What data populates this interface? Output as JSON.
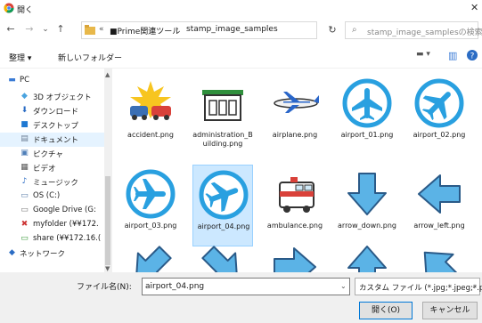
{
  "window": {
    "title": "開く",
    "close_glyph": "✕"
  },
  "nav": {
    "back_glyph": "←",
    "forward_glyph": "→",
    "recent_glyph": "⌄",
    "up_glyph": "↑",
    "address_overflow": "«",
    "address_segments": [
      "■Prime関連ツール",
      "stamp_image_samples"
    ],
    "address_separator": "›",
    "refresh_glyph": "↻",
    "search_placeholder": "stamp_image_samplesの検索"
  },
  "toolbar": {
    "organize_label": "整理 ▾",
    "new_folder_label": "新しいフォルダー"
  },
  "sidebar": {
    "items": [
      {
        "label": "PC",
        "icon": "pc-icon",
        "glyph": "▬",
        "color": "#3a7bd5",
        "indent": 0
      },
      {
        "label": "3D オブジェクト",
        "icon": "3d-objects-icon",
        "glyph": "◆",
        "color": "#4aa3df",
        "indent": 1
      },
      {
        "label": "ダウンロード",
        "icon": "download-icon",
        "glyph": "⬇",
        "color": "#2b6cc4",
        "indent": 1
      },
      {
        "label": "デスクトップ",
        "icon": "desktop-icon",
        "glyph": "■",
        "color": "#1e78d2",
        "indent": 1
      },
      {
        "label": "ドキュメント",
        "icon": "documents-icon",
        "glyph": "▤",
        "color": "#6b7c93",
        "indent": 1,
        "selected": true
      },
      {
        "label": "ピクチャ",
        "icon": "pictures-icon",
        "glyph": "▣",
        "color": "#4f7fb8",
        "indent": 1
      },
      {
        "label": "ビデオ",
        "icon": "videos-icon",
        "glyph": "▦",
        "color": "#555555",
        "indent": 1
      },
      {
        "label": "ミュージック",
        "icon": "music-icon",
        "glyph": "♪",
        "color": "#2b6cc4",
        "indent": 1
      },
      {
        "label": "OS (C:)",
        "icon": "drive-icon",
        "glyph": "▭",
        "color": "#5b7ea8",
        "indent": 1
      },
      {
        "label": "Google Drive (G:",
        "icon": "google-drive-icon",
        "glyph": "▭",
        "color": "#777777",
        "indent": 1
      },
      {
        "label": "myfolder (¥¥172.",
        "icon": "network-drive-disconnected-icon",
        "glyph": "✖",
        "color": "#cc3333",
        "indent": 1
      },
      {
        "label": "share (¥¥172.16.(",
        "icon": "network-drive-icon",
        "glyph": "▭",
        "color": "#3a9a3a",
        "indent": 1
      },
      {
        "label": "ネットワーク",
        "icon": "network-icon",
        "glyph": "◆",
        "color": "#2b6cc4",
        "indent": 0
      }
    ]
  },
  "files": [
    {
      "name": "accident.png",
      "icon": "accident-icon"
    },
    {
      "name": "administration_Building.png",
      "icon": "administration-building-icon"
    },
    {
      "name": "airplane.png",
      "icon": "airplane-icon"
    },
    {
      "name": "airport_01.png",
      "icon": "airport-01-icon"
    },
    {
      "name": "airport_02.png",
      "icon": "airport-02-icon"
    },
    {
      "name": "airport_03.png",
      "icon": "airport-03-icon"
    },
    {
      "name": "airport_04.png",
      "icon": "airport-04-icon",
      "selected": true
    },
    {
      "name": "ambulance.png",
      "icon": "ambulance-icon"
    },
    {
      "name": "arrow_down.png",
      "icon": "arrow-down-icon"
    },
    {
      "name": "arrow_left.png",
      "icon": "arrow-left-icon"
    },
    {
      "name": "",
      "icon": "arrow-down-left-icon"
    },
    {
      "name": "",
      "icon": "arrow-down-right-icon"
    },
    {
      "name": "",
      "icon": "arrow-right-icon"
    },
    {
      "name": "",
      "icon": "arrow-up-icon"
    },
    {
      "name": "",
      "icon": "arrow-up-left-icon"
    }
  ],
  "footer": {
    "filename_label": "ファイル名(N):",
    "filename_value": "airport_04.png",
    "filter_value": "カスタム ファイル (*.jpg;*.jpeg;*.pn",
    "open_label": "開く(O)",
    "cancel_label": "キャンセル"
  },
  "colors": {
    "accent": "#0078d7",
    "selection": "#cce8ff",
    "airport_blue": "#29a0e0",
    "arrow_blue": "#5bb3e6"
  }
}
